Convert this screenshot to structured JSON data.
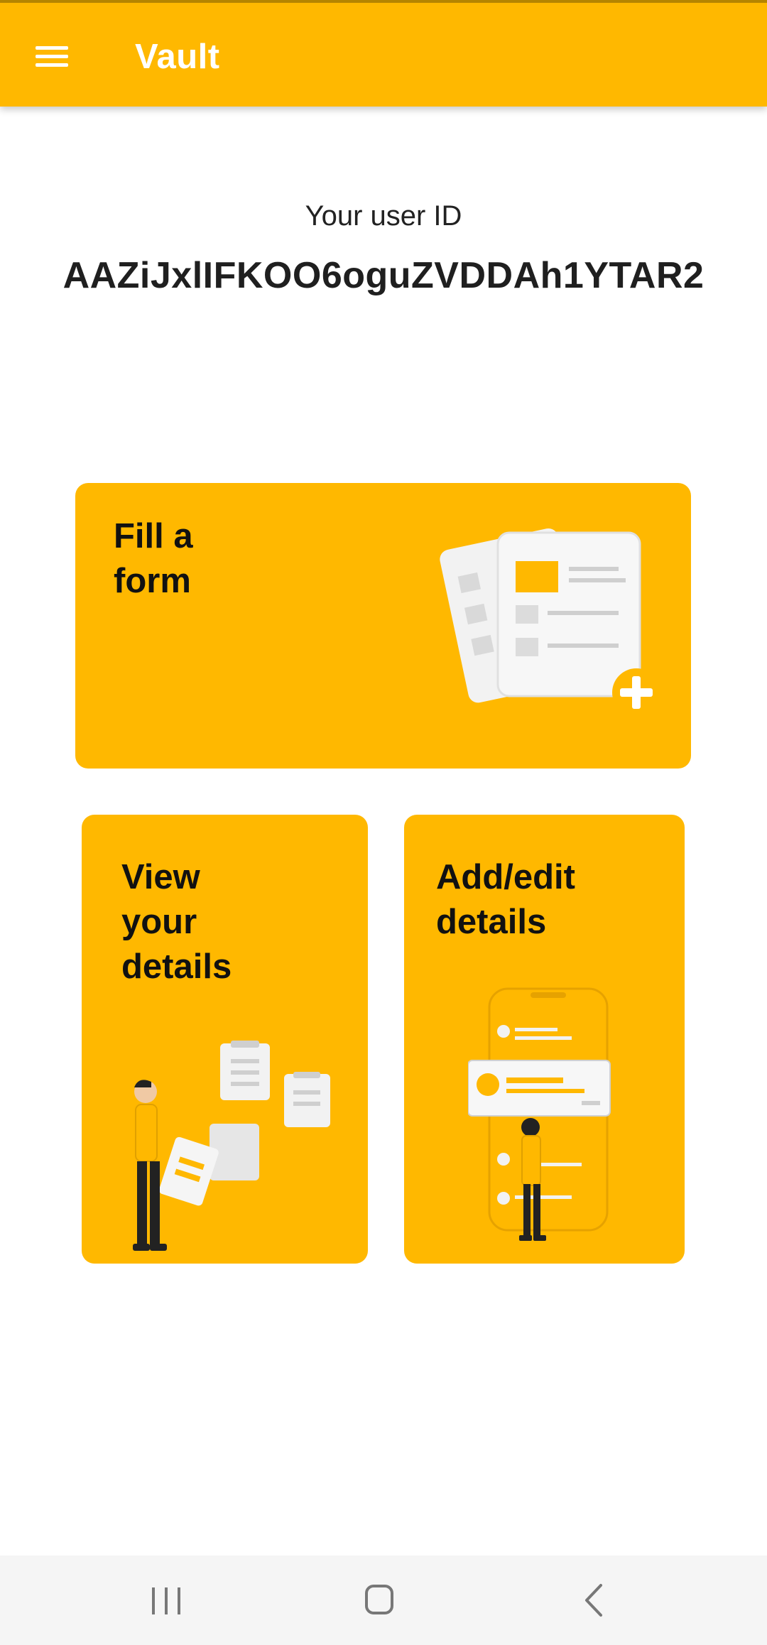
{
  "app_bar": {
    "title": "Vault",
    "menu_icon": "hamburger-menu-icon",
    "background": "#FFB800"
  },
  "user": {
    "label": "Your user ID",
    "id": "AAZiJxlIFKOO6oguZVDDAh1YTAR2"
  },
  "cards": {
    "fill_form": {
      "label": "Fill a\nform",
      "illustration": "documents-add-illustration"
    },
    "view_details": {
      "label": "View\nyour\ndetails",
      "illustration": "person-with-notes-illustration"
    },
    "add_edit_details": {
      "label": "Add/edit\ndetails",
      "illustration": "phone-profile-card-illustration"
    }
  },
  "system_nav": {
    "recents": "recents-icon",
    "home": "home-icon",
    "back": "back-icon"
  },
  "colors": {
    "accent": "#FFB800",
    "card_text": "#111111",
    "nav_background": "#F5F5F5"
  }
}
